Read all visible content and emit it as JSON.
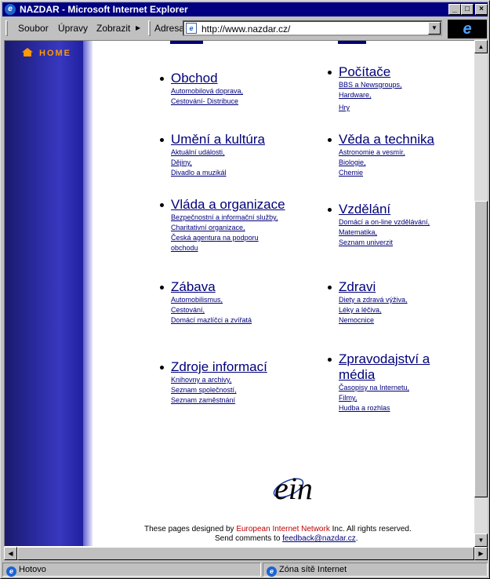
{
  "window": {
    "title": "NAZDAR - Microsoft Internet Explorer"
  },
  "menu": {
    "items": [
      "Soubor",
      "Úpravy",
      "Zobrazit",
      "Adresa"
    ]
  },
  "address": {
    "url": "http://www.nazdar.cz/"
  },
  "sidebar": {
    "home_label": "HOME"
  },
  "categories": [
    {
      "title": "Obchod",
      "subs": [
        "Automobilová doprava,",
        "Cestování- Distribuce"
      ]
    },
    {
      "title": "Počítače",
      "subs": [
        "BBS a Newsgroups,",
        "Hardware,",
        "Hry"
      ]
    },
    {
      "title": "Umění a kultúra",
      "subs": [
        "Aktuální události,",
        "Dějiny,",
        "Divadlo a muzikál"
      ]
    },
    {
      "title": "Věda a technika",
      "subs": [
        "Astronomie a vesmír,",
        "Biologie,",
        "Chemie"
      ]
    },
    {
      "title": "Vláda a organizace",
      "subs": [
        "Bezpečnostní a informační služby,",
        "Charitativní organizace,",
        "Česká agentura na podporu",
        "obchodu"
      ]
    },
    {
      "title": "Vzdělání",
      "subs": [
        "Domácí a on-line vzdělávání,",
        "Matematika,",
        "Seznam univerzit"
      ]
    },
    {
      "title": "Zábava",
      "subs": [
        "Automobilismus,",
        "Cestování,",
        "Domácí mazlíčci a zvířatá"
      ]
    },
    {
      "title": "Zdravi",
      "subs": [
        "Diety a zdravá výživa,",
        "Léky a léčiva,",
        "Nemocnice"
      ]
    },
    {
      "title": "Zdroje informací",
      "subs": [
        "Knihovny a archivy,",
        "Seznam společností,",
        "Seznam zaměstnání"
      ]
    },
    {
      "title": "Zpravodajství a média",
      "subs": [
        "Časopisy na Internetu,",
        "Filmy,",
        "Hudba a rozhlas"
      ]
    }
  ],
  "logo": {
    "text": "ein"
  },
  "footer": {
    "line1_prefix": "These pages designed by ",
    "line1_link": "European Internet Network",
    "line1_suffix": " Inc. All rights reserved.",
    "line2_prefix": "Send comments to ",
    "line2_email": "feedback@nazdar.cz",
    "line2_suffix": "."
  },
  "status": {
    "left": "Hotovo",
    "zone": "Zóna sítě Internet"
  },
  "colors": {
    "titlebar": "#000080",
    "link": "#00007a",
    "home": "#ff9900",
    "ein_link": "#c00000"
  }
}
